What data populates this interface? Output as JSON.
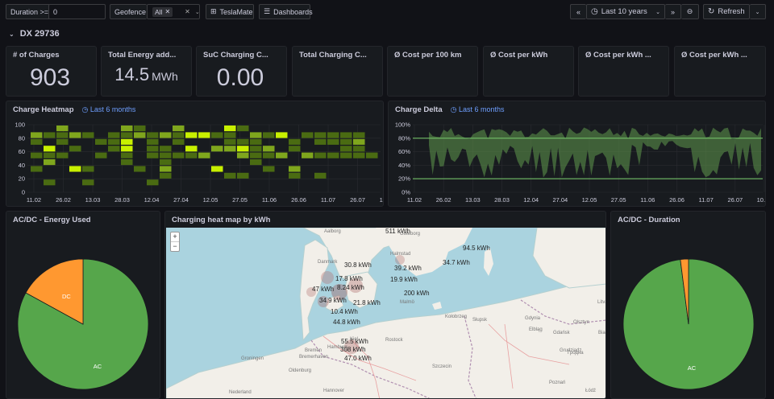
{
  "toolbar": {
    "duration_label": "Duration >=",
    "duration_value": "0",
    "geofence_label": "Geofence",
    "geofence_value": "All",
    "teslamate_label": "TeslaMate",
    "dashboards_label": "Dashboards",
    "time_range": "Last 10 years",
    "refresh_label": "Refresh"
  },
  "row": {
    "title": "DX 29736"
  },
  "stats": [
    {
      "title": "# of Charges",
      "value": "903",
      "unit": ""
    },
    {
      "title": "Total Energy add...",
      "value": "14.5",
      "unit": "MWh"
    },
    {
      "title": "SuC Charging C...",
      "value": "0.00",
      "unit": ""
    },
    {
      "title": "Total Charging C...",
      "value": "",
      "unit": ""
    },
    {
      "title": "Ø Cost per 100 km",
      "value": "",
      "unit": ""
    },
    {
      "title": "Ø Cost per kWh",
      "value": "",
      "unit": ""
    },
    {
      "title": "Ø Cost per kWh ...",
      "value": "",
      "unit": ""
    },
    {
      "title": "Ø Cost per kWh ...",
      "value": "",
      "unit": ""
    }
  ],
  "heatmap_panel": {
    "title": "Charge Heatmap",
    "time_range": "Last 6 months"
  },
  "delta_panel": {
    "title": "Charge Delta",
    "time_range": "Last 6 months"
  },
  "energy_pie_panel": {
    "title": "AC/DC - Energy Used"
  },
  "map_panel": {
    "title": "Charging heat map by kWh"
  },
  "duration_pie_panel": {
    "title": "AC/DC - Duration"
  },
  "colors": {
    "ac": "#56a64b",
    "dc": "#ff9830",
    "heat_low": "#4a6b12",
    "heat_high": "#c8f000",
    "delta": "#5a8f4a"
  },
  "chart_data": [
    {
      "type": "heatmap",
      "title": "Charge Heatmap",
      "x_ticks": [
        "11.02",
        "26.02",
        "13.03",
        "28.03",
        "12.04",
        "27.04",
        "12.05",
        "27.05",
        "11.06",
        "26.06",
        "11.07",
        "26.07",
        "10.08"
      ],
      "y_ticks": [
        "0",
        "20",
        "40",
        "60",
        "80",
        "100"
      ],
      "ylim": [
        0,
        100
      ]
    },
    {
      "type": "area",
      "title": "Charge Delta",
      "x_ticks": [
        "11.02",
        "26.02",
        "13.03",
        "28.03",
        "12.04",
        "27.04",
        "12.05",
        "27.05",
        "11.06",
        "26.06",
        "11.07",
        "26.07",
        "10.08"
      ],
      "y_ticks": [
        "0%",
        "20%",
        "40%",
        "60%",
        "80%",
        "100%"
      ],
      "ylim": [
        0,
        100
      ],
      "threshold_lines": [
        20,
        80
      ]
    },
    {
      "type": "pie",
      "title": "AC/DC - Energy Used",
      "labels": [
        "AC",
        "DC"
      ],
      "values": [
        83,
        17
      ]
    },
    {
      "type": "pie",
      "title": "AC/DC - Duration",
      "labels": [
        "AC",
        "DC"
      ],
      "values": [
        98,
        2
      ]
    }
  ],
  "map": {
    "zoom_in": "+",
    "zoom_out": "−",
    "kwh_labels": [
      "511 kWh",
      "94.5 kWh",
      "34.7 kWh",
      "30.8 kWh",
      "39.2 kWh",
      "17.8 kWh",
      "19.9 kWh",
      "8.24 kWh",
      "47 kWh",
      "200 kWh",
      "34.9 kWh",
      "21.8 kWh",
      "10.4 kWh",
      "44.8 kWh",
      "55.5 kWh",
      "308 kWh",
      "47.0 kWh"
    ],
    "places": [
      "Aalborg",
      "Danmark",
      "Halmstad",
      "Groningen",
      "Bremen",
      "Hamburg",
      "Hannover",
      "Gdańsk",
      "Grudziądz",
      "Poznań",
      "Litva",
      "Гродна",
      "Nederland",
      "Göteborg",
      "Malmö",
      "Szczecin",
      "Rostock",
      "Kiel",
      "Oldenburg",
      "Bremerhaven",
      "Łódź",
      "Gdynia",
      "Słupsk",
      "Kołobrzeg",
      "Elbląg",
      "Olsztyn",
      "Białystok"
    ]
  }
}
